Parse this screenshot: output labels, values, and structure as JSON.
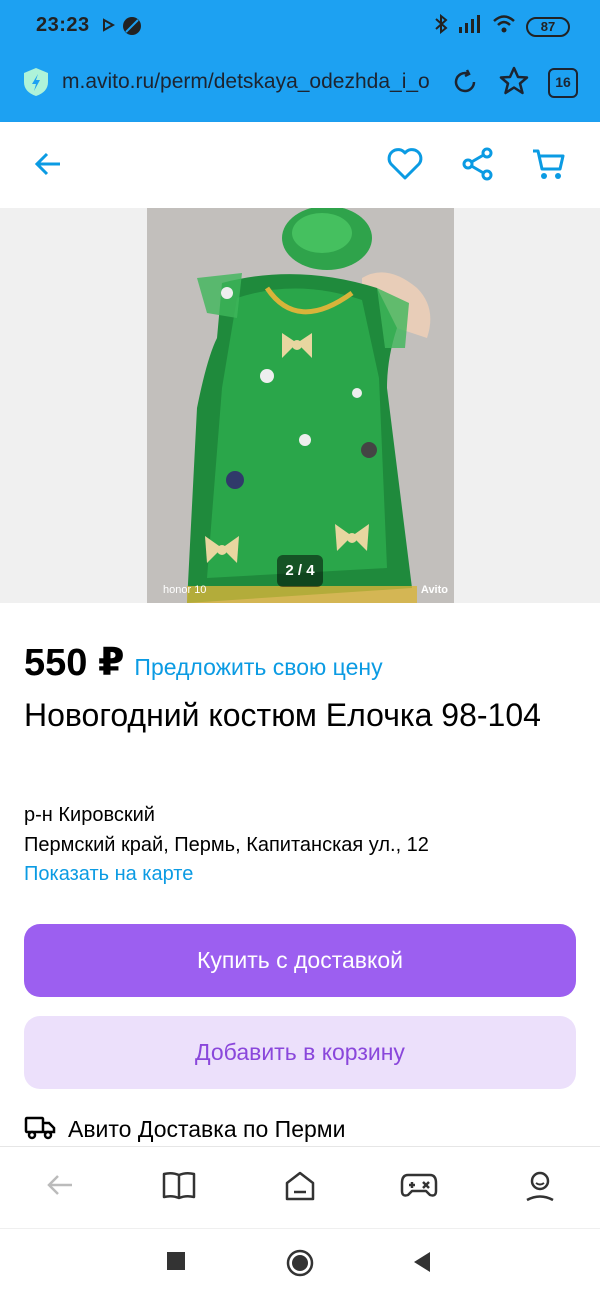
{
  "status_bar": {
    "time": "23:23",
    "battery": "87"
  },
  "browser": {
    "url": "m.avito.ru/perm/detskaya_odezhda_i_o",
    "tab_count": "16"
  },
  "gallery": {
    "counter": "2 / 4",
    "watermark_left": "honor 10",
    "watermark_right": "Avito"
  },
  "listing": {
    "price": "550 ₽",
    "offer_link": "Предложить свою цену",
    "title": "Новогодний костюм Елочка 98-104",
    "district": "р-н Кировский",
    "address": "Пермский край, Пермь, Капитанская ул., 12",
    "map_link": "Показать на карте",
    "buy_button": "Купить с доставкой",
    "add_button": "Добавить в корзину",
    "delivery": "Авито Доставка по Перми"
  },
  "colors": {
    "browser_bar": "#1da1f2",
    "accent_blue": "#0b9be3",
    "buy_purple": "#9c5ff0",
    "add_purple_bg": "#ece0fb"
  },
  "icons": [
    "back-arrow-icon",
    "heart-icon",
    "share-icon",
    "cart-icon",
    "truck-icon",
    "book-icon",
    "home-icon",
    "gamepad-icon",
    "profile-icon"
  ]
}
